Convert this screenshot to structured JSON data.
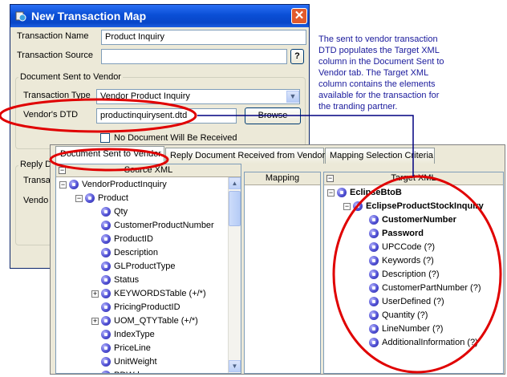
{
  "dialog": {
    "title": "New Transaction Map",
    "close_glyph": "✕",
    "transaction_name_label": "Transaction Name",
    "transaction_name_value": "Product Inquiry",
    "transaction_source_label": "Transaction Source",
    "transaction_source_value": "",
    "help_glyph": "?",
    "sent_group_label": "Document Sent to Vendor",
    "transaction_type_label": "Transaction Type",
    "transaction_type_value": "Vendor Product Inquiry",
    "vendors_dtd_label": "Vendor's DTD",
    "vendors_dtd_value": "productinquirysent.dtd",
    "browse_label": "Browse",
    "no_document_label": "No Document Will Be Received",
    "reply_group_label": "Reply D",
    "reply_transaction_label": "Transa",
    "reply_vendor_label": "Vendo"
  },
  "note": "The sent to vendor transaction DTD populates the Target XML column in the Document Sent to Vendor tab. The Target XML column contains the elements available for the transaction for the tranding partner.",
  "tabs": [
    {
      "label": "Document Sent to Vendor",
      "active": true
    },
    {
      "label": "Reply Document Received from Vendor",
      "active": false
    },
    {
      "label": "Mapping Selection Criteria",
      "active": false
    }
  ],
  "panels": {
    "source_header": "Source XML",
    "mapping_header": "Mapping",
    "target_header": "Target XML"
  },
  "source_tree": [
    {
      "label": "VendorProductInquiry",
      "level": 0,
      "expander": "−"
    },
    {
      "label": "Product",
      "level": 1,
      "expander": "−"
    },
    {
      "label": "Qty",
      "level": 2
    },
    {
      "label": "CustomerProductNumber",
      "level": 2
    },
    {
      "label": "ProductID",
      "level": 2
    },
    {
      "label": "Description",
      "level": 2
    },
    {
      "label": "GLProductType",
      "level": 2
    },
    {
      "label": "Status",
      "level": 2
    },
    {
      "label": "KEYWORDSTable (+/*)",
      "level": 2,
      "expander": "+"
    },
    {
      "label": "PricingProductID",
      "level": 2
    },
    {
      "label": "UOM_QTYTable (+/*)",
      "level": 2,
      "expander": "+"
    },
    {
      "label": "IndexType",
      "level": 2
    },
    {
      "label": "PriceLine",
      "level": 2
    },
    {
      "label": "UnitWeight",
      "level": 2
    },
    {
      "label": "PDWd",
      "level": 2
    }
  ],
  "target_tree": [
    {
      "label": "EclipseBtoB",
      "level": 0,
      "expander": "−",
      "bold": true
    },
    {
      "label": "EclipseProductStockInquiry",
      "level": 1,
      "expander": "−",
      "bold": true
    },
    {
      "label": "CustomerNumber",
      "level": 2,
      "bold": true
    },
    {
      "label": "Password",
      "level": 2,
      "bold": true
    },
    {
      "label": "UPCCode (?)",
      "level": 2
    },
    {
      "label": "Keywords (?)",
      "level": 2
    },
    {
      "label": "Description (?)",
      "level": 2
    },
    {
      "label": "CustomerPartNumber (?)",
      "level": 2
    },
    {
      "label": "UserDefined (?)",
      "level": 2
    },
    {
      "label": "Quantity (?)",
      "level": 2
    },
    {
      "label": "LineNumber (?)",
      "level": 2
    },
    {
      "label": "AdditionalInformation (?)",
      "level": 2
    }
  ],
  "colors": {
    "highlight": "#e00000",
    "connector": "#000080",
    "note_text": "#1a1a9c",
    "titlebar": "#0a4fd6"
  },
  "icons": {
    "app": "transaction-map-icon",
    "node": "xml-element-icon"
  }
}
